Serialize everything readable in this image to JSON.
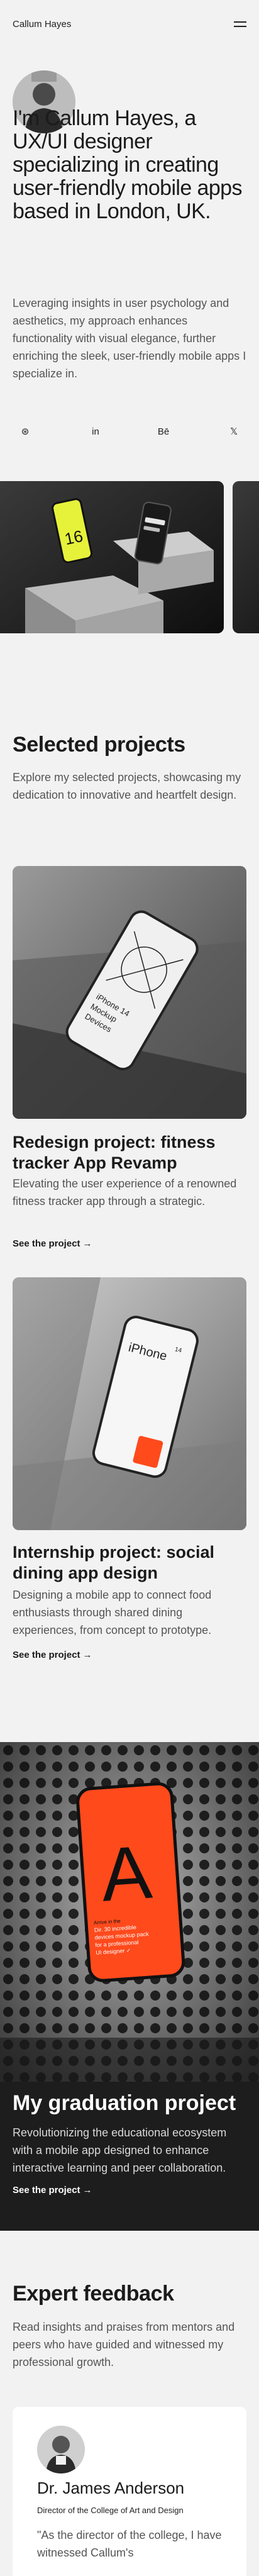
{
  "header": {
    "brand": "Callum Hayes"
  },
  "hero": {
    "title": "I'm Callum Hayes, a UX/UI designer specializing in creating user-friendly mobile apps based in London, UK.",
    "text": "Leveraging insights in user psychology and aesthetics, my approach enhances functionality with visual elegance, further enriching the sleek, user-friendly mobile apps I specialize in.",
    "socials": [
      {
        "icon": "dribbble-icon",
        "glyph": "⊛"
      },
      {
        "icon": "linkedin-icon",
        "glyph": "in"
      },
      {
        "icon": "behance-icon",
        "glyph": "Bē"
      },
      {
        "icon": "x-icon",
        "glyph": "𝕏"
      }
    ]
  },
  "carousel": {
    "phone_text": "16"
  },
  "projects_section": {
    "title": "Selected projects",
    "text": "Explore my selected projects, showcasing my dedication to innovative and heartfelt design."
  },
  "projects": [
    {
      "title": "Redesign project: fitness tracker App Revamp",
      "desc": "Elevating the user experience of a renowned fitness tracker app through a strategic.",
      "link": "See the project",
      "mockup_lines": [
        "iPhone 14",
        "Mockup",
        "Devices"
      ]
    },
    {
      "title": "Internship project: social dining app design",
      "desc": "Designing a mobile app to connect food enthusiasts through shared dining experiences, from concept to prototype.",
      "link": "See the project",
      "mockup_lines": [
        "iPhone",
        "14"
      ]
    }
  ],
  "graduation": {
    "title": "My graduation project",
    "text": "Revolutionizing the educational ecosystem with a mobile app designed to enhance interactive learning and peer collaboration.",
    "link": "See the project",
    "letter": "A",
    "screen_lines": [
      "Arrive in the",
      "Dir. 30 incredible",
      "devices mockup pack",
      "for a professional",
      "UI designer ✓"
    ]
  },
  "feedback": {
    "title": "Expert feedback",
    "text": "Read insights and praises from mentors and peers who have guided and witnessed my professional growth.",
    "name": "Dr. James Anderson",
    "role": "Director of the College of Art and Design",
    "quote": "\"As the director of the college, I have witnessed Callum's"
  },
  "colors": {
    "background": "#f2f2f2",
    "dark": "#1d1d1d",
    "accent_orange": "#ff4a1c",
    "accent_yellow": "#e6f23a"
  },
  "arrow": "→"
}
